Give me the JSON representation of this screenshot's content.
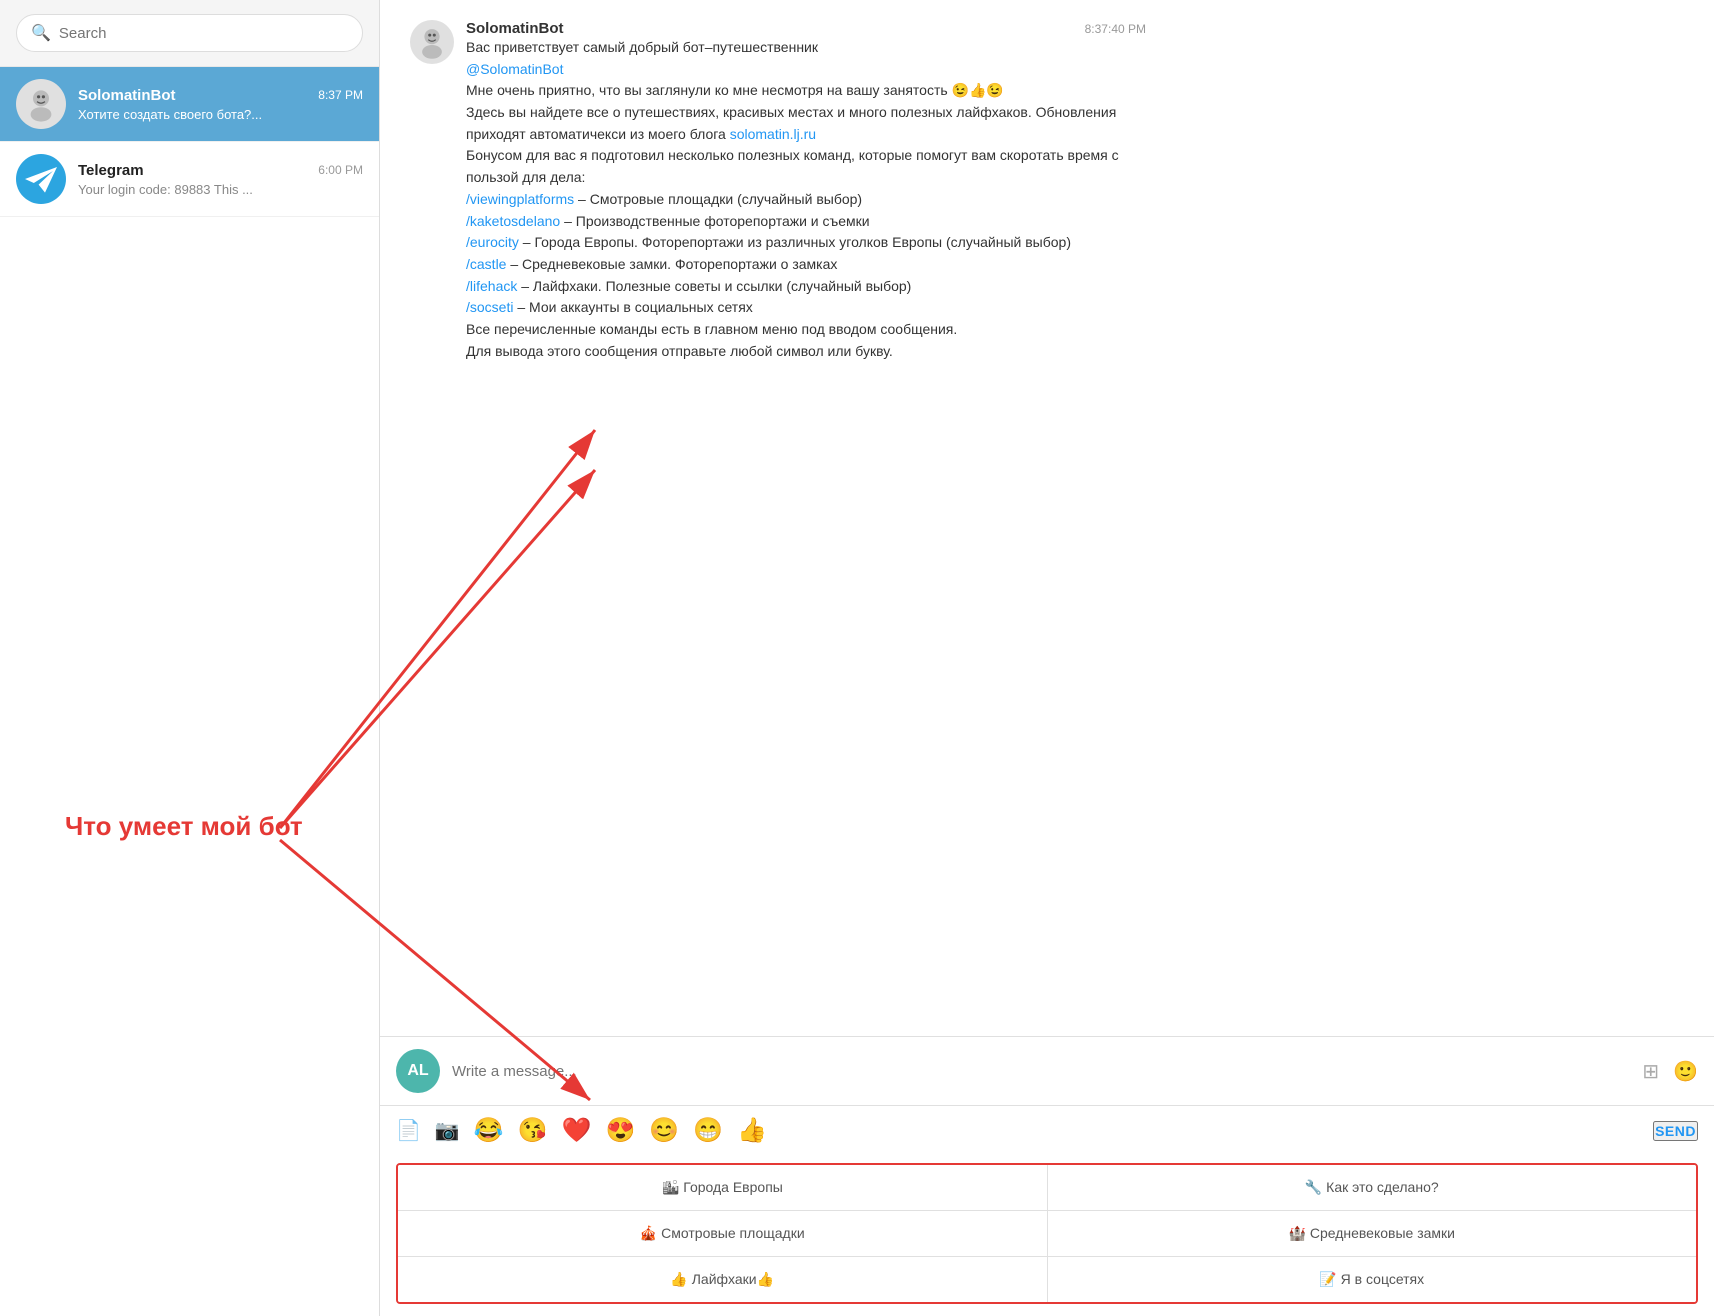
{
  "sidebar": {
    "search_placeholder": "Search",
    "chats": [
      {
        "id": "solomatinbot",
        "name": "SolomatinBot",
        "preview": "Хотите создать своего бота?...",
        "time": "8:37 PM",
        "active": true,
        "avatar_type": "bot"
      },
      {
        "id": "telegram",
        "name": "Telegram",
        "preview": "Your login code: 89883 This ...",
        "time": "6:00 PM",
        "active": false,
        "avatar_type": "telegram"
      }
    ]
  },
  "chat": {
    "bot_name": "SolomatinBot",
    "message_time": "8:37:40 PM",
    "message_lines": [
      "Вас приветствует самый добрый бот–путешественник",
      "@SolomatinBot",
      "Мне очень приятно, что вы заглянули ко мне несмотря на вашу занятость 😉👍😉",
      "Здесь вы найдете все о путешествиях, красивых местах и много полезных лайфхаков. Обновления приходят автоматичекси из моего блога solomatin.lj.ru",
      "Бонусом для вас я подготовил несколько полезных команд, которые помогут вам скоротать время с пользой для дела:",
      "/viewingplatforms – Смотровые площадки (случайный выбор)",
      "/kaketosdelano – Производственные фоторепортажи и съемки",
      "/eurocity – Города Европы. Фоторепортажи из различных уголков Европы (случайный выбор)",
      "/castle – Средневековые замки. Фоторепортажи о замках",
      "/lifehack – Лайфхаки. Полезные советы и ссылки (случайный выбор)",
      "/socseti – Мои аккаунты в социальных сетях",
      "Все перечисленные команды есть в главном меню под вводом сообщения.",
      "Для вывода этого сообщения отправьте любой символ или букву."
    ],
    "links": {
      "solomatin": "solomatin.lj.ru",
      "viewingplatforms": "/viewingplatforms",
      "kaketosdelano": "/kaketosdelano",
      "eurocity": "/eurocity",
      "castle": "/castle",
      "lifehack": "/lifehack",
      "socseti": "/socseti"
    },
    "input_placeholder": "Write a message...",
    "user_initials": "AL",
    "send_label": "SEND",
    "toolbar_emojis": [
      "😂",
      "😘",
      "❤️",
      "😍",
      "😊",
      "😁",
      "👍"
    ],
    "keyboard_buttons": [
      [
        "🏙 Города Европы",
        "🔧 Как это сделано?"
      ],
      [
        "🎪 Смотровые площадки",
        "🏰 Средневековые замки"
      ],
      [
        "👍 Лайфхаки👍",
        "📝 Я в соцсетях"
      ]
    ]
  },
  "annotation": {
    "text": "Что умеет мой бот"
  }
}
